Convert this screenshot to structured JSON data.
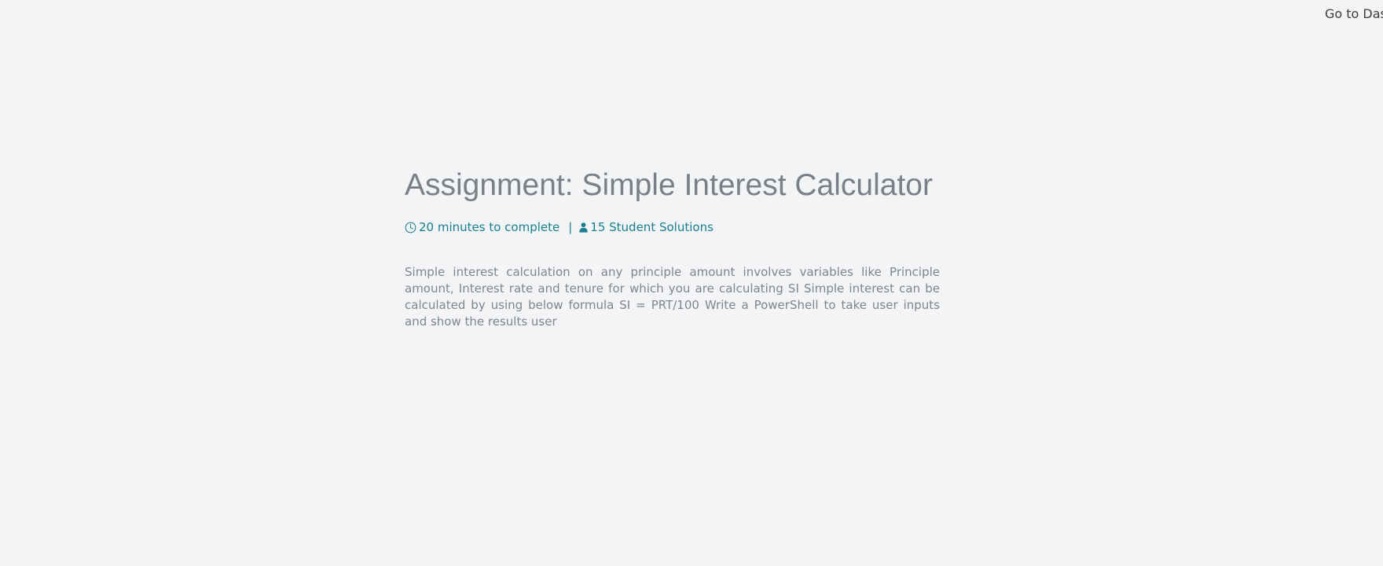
{
  "header": {
    "dashboard_link": "Go to Dashboard"
  },
  "assignment": {
    "title": "Assignment: Simple Interest Calculator",
    "time_to_complete": "20 minutes to complete",
    "separator": "|",
    "solutions": "15 Student Solutions",
    "description": "Simple interest calculation on any principle amount involves variables like Principle amount, Interest rate and tenure for which you are calculating SI Simple interest can be calculated by using below formula SI = PRT/100 Write a PowerShell to take user inputs and show the results user"
  },
  "icons": {
    "time": "clock-icon",
    "solutions": "user-icon"
  },
  "colors": {
    "background": "#f2f4f6",
    "accent": "#1a7f8e",
    "title": "#7a7f88",
    "body_text": "#80858d"
  }
}
